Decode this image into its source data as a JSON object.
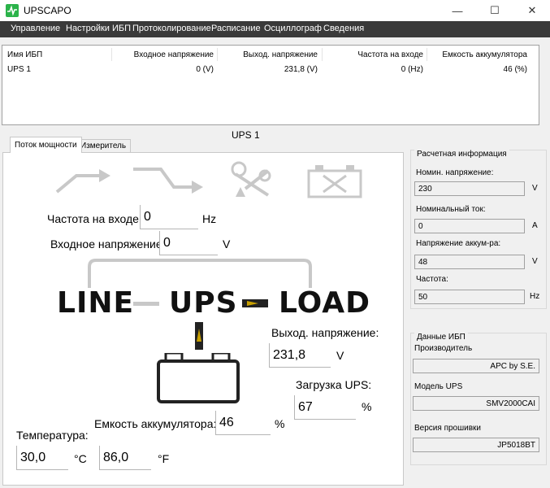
{
  "window": {
    "title": "UPSCAPO",
    "controls": {
      "minimize": "—",
      "maximize": "☐",
      "close": "✕"
    }
  },
  "menu": [
    "Управление",
    "Настройки ИБП",
    "Протоколирование",
    "Расписание",
    "Осциллограф",
    "Сведения"
  ],
  "table": {
    "headers": [
      "Имя ИБП",
      "Входное напряжение",
      "Выход. напряжение",
      "Частота на входе",
      "Емкость аккумулятора"
    ],
    "rows": [
      [
        "UPS 1",
        "0 (V)",
        "231,8 (V)",
        "0 (Hz)",
        "46 (%)"
      ]
    ]
  },
  "panel_title": "UPS 1",
  "tabs": [
    "Поток мощности",
    "Измеритель"
  ],
  "flow": {
    "input_frequency": {
      "label": "Частота на входе:",
      "value": "0",
      "unit": "Hz"
    },
    "input_voltage": {
      "label": "Входное напряжение:",
      "value": "0",
      "unit": "V"
    },
    "line_word": "LINE",
    "ups_word": "UPS",
    "load_word": "LOAD",
    "output_voltage": {
      "label": "Выход. напряжение:",
      "value": "231,8",
      "unit": "V"
    },
    "ups_load": {
      "label": "Загрузка UPS:",
      "value": "67",
      "unit": "%"
    },
    "battery_capacity": {
      "label": "Емкость аккумулятора:",
      "value": "46",
      "unit": "%"
    },
    "temperature": {
      "label": "Температура:",
      "celsius": "30,0",
      "celsius_unit": "°C",
      "fahrenheit": "86,0",
      "fahrenheit_unit": "°F"
    }
  },
  "calc_info": {
    "title": "Расчетная информация",
    "items": [
      {
        "label": "Номин. напряжение:",
        "value": "230",
        "unit": "V"
      },
      {
        "label": "Номинальный ток:",
        "value": "0",
        "unit": "A"
      },
      {
        "label": "Напряжение аккум-ра:",
        "value": "48",
        "unit": "V"
      },
      {
        "label": "Частота:",
        "value": "50",
        "unit": "Hz"
      }
    ]
  },
  "ups_data": {
    "title": "Данные ИБП",
    "items": [
      {
        "label": "Производитель",
        "value": "APC by S.E."
      },
      {
        "label": "Модель UPS",
        "value": "SMV2000CAI"
      },
      {
        "label": "Версия прошивки",
        "value": "JP5018BT"
      }
    ]
  },
  "colors": {
    "menubar": "#3a3a3a",
    "app_icon": "#2bb34a",
    "flow_inactive": "#c8c8c8",
    "flow_arrow": "#c8a000"
  }
}
